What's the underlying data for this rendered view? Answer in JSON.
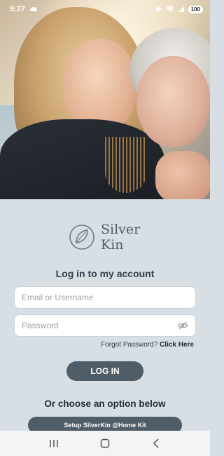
{
  "status_bar": {
    "time": "9:27",
    "battery": "100"
  },
  "brand": {
    "line1": "Silver",
    "line2": "Kin"
  },
  "login": {
    "heading": "Log in to my account",
    "email_placeholder": "Email or Username",
    "password_placeholder": "Password",
    "forgot_prefix": "Forgot Password?",
    "forgot_link": "Click Here",
    "login_button": "LOG IN"
  },
  "options": {
    "heading": "Or choose an option below",
    "setup_button": "Setup SilverKin @Home Kit"
  },
  "icons": {
    "cloud": "cloud-icon",
    "mute": "mute-icon",
    "wifi": "wifi-icon",
    "signal": "signal-icon",
    "eye_off": "eye-off-icon",
    "nav_recents": "recents-icon",
    "nav_home": "home-icon",
    "nav_back": "back-icon"
  },
  "colors": {
    "primary": "#4f5d68",
    "background": "#d8dfe4",
    "logo": "#4d5d6b"
  }
}
